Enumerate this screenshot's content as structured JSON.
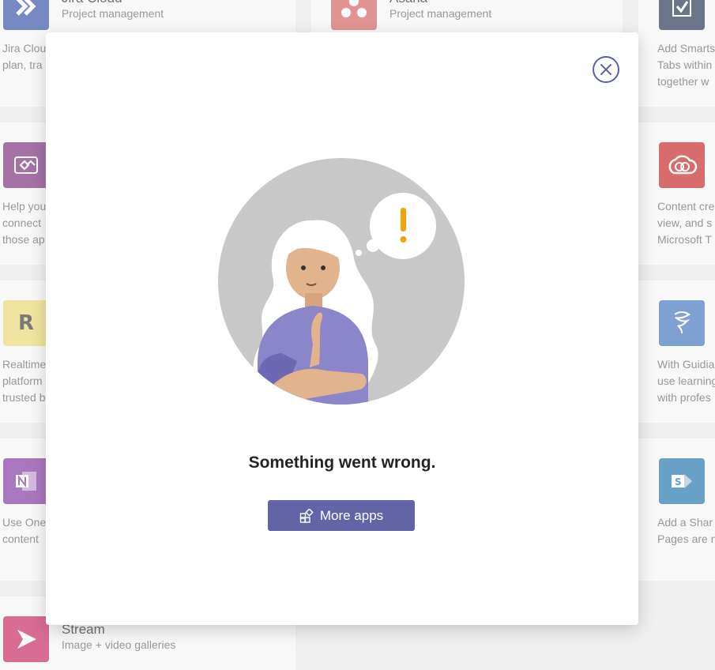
{
  "background_apps": [
    {
      "name": "Jira Cloud",
      "category": "Project management",
      "description": "Jira Clou\nplan, tra",
      "icon": "jira-icon",
      "color": "#2d4aa0"
    },
    {
      "name": "Asana",
      "category": "Project management",
      "description": "",
      "icon": "asana-icon",
      "color": "#d35a5a"
    },
    {
      "name": "",
      "category": "",
      "description": "Add Smarts\nTabs within\ntogether w",
      "icon": "smartsheet-icon",
      "color": "#1e2a4a"
    },
    {
      "name": "",
      "category": "",
      "description": "Help you\nconnect\nthose ap",
      "icon": "power-apps-icon",
      "color": "#742774"
    },
    {
      "name": "",
      "category": "",
      "description": "Content cre\nview, and s\nMicrosoft T",
      "icon": "creative-cloud-icon",
      "color": "#c41e1e"
    },
    {
      "name": "",
      "category": "",
      "description": "Realtime\nplatform\ntrusted b",
      "icon": "r-icon",
      "icon_text": "R",
      "color": "#e7d66e"
    },
    {
      "name": "",
      "category": "",
      "description": "With Guidia\nuse learning\nwith profes",
      "icon": "guidial-icon",
      "color": "#3a6fb8"
    },
    {
      "name": "",
      "category": "",
      "description": "Use One\ncontent",
      "icon": "onenote-icon",
      "color": "#7b2f9a"
    },
    {
      "name": "",
      "category": "",
      "description": "Add a Shar\nPages are n",
      "icon": "sharepoint-icon",
      "color": "#1a6fa8"
    },
    {
      "name": "Stream",
      "category": "Image + video galleries",
      "description": "",
      "icon": "stream-icon",
      "color": "#c41e5a"
    }
  ],
  "dialog": {
    "close_icon": "close-icon",
    "illustration": "confused-person-illustration",
    "error_message": "Something went wrong.",
    "more_apps_button": {
      "label": "More apps",
      "icon": "apps-icon"
    }
  },
  "colors": {
    "accent": "#6264a7",
    "close_ring": "#5b5fa8",
    "warning": "#f0a30a"
  }
}
